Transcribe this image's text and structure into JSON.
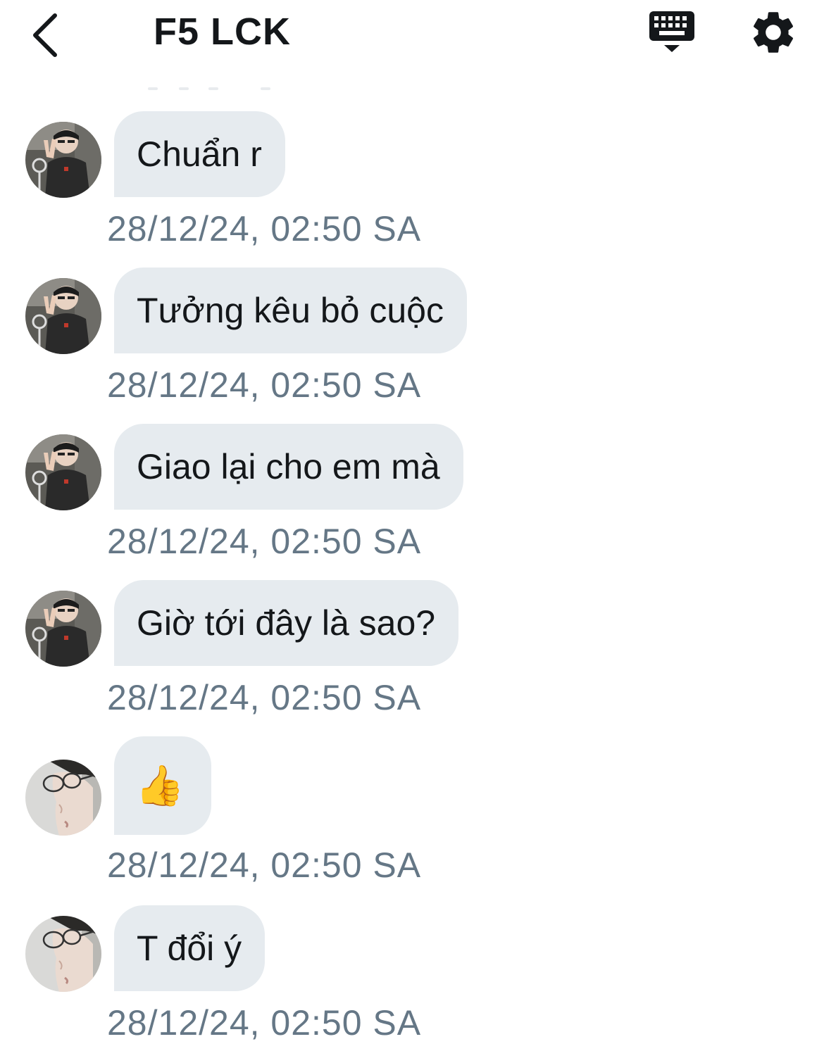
{
  "header": {
    "title": "F5 LCK",
    "back_icon": "chevron-left-icon",
    "keyboard_icon": "keyboard-hide-icon",
    "settings_icon": "gear-icon"
  },
  "colors": {
    "bubble_bg": "#e6ebef",
    "text": "#14171a",
    "timestamp": "#657786"
  },
  "messages": [
    {
      "text": "Chuẩn r",
      "timestamp": "28/12/24, 02:50 SA",
      "sender_avatar": "peace-sign-avatar"
    },
    {
      "text": "Tưởng kêu bỏ cuộc",
      "timestamp": "28/12/24, 02:50 SA",
      "sender_avatar": "peace-sign-avatar"
    },
    {
      "text": "Giao lại cho em mà",
      "timestamp": "28/12/24, 02:50 SA",
      "sender_avatar": "peace-sign-avatar"
    },
    {
      "text": "Giờ tới đây là sao?",
      "timestamp": "28/12/24, 02:50 SA",
      "sender_avatar": "peace-sign-avatar"
    },
    {
      "text": "👍",
      "timestamp": "28/12/24, 02:50 SA",
      "sender_avatar": "glasses-profile-avatar"
    },
    {
      "text": "T đổi ý",
      "timestamp": "28/12/24, 02:50 SA",
      "sender_avatar": "glasses-profile-avatar"
    }
  ]
}
